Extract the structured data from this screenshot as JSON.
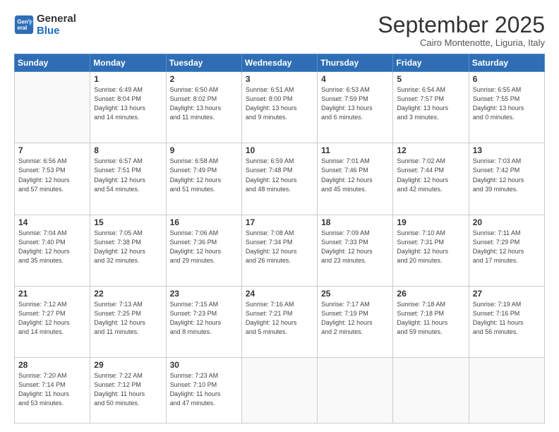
{
  "logo": {
    "text_general": "General",
    "text_blue": "Blue"
  },
  "header": {
    "month": "September 2025",
    "location": "Cairo Montenotte, Liguria, Italy"
  },
  "weekdays": [
    "Sunday",
    "Monday",
    "Tuesday",
    "Wednesday",
    "Thursday",
    "Friday",
    "Saturday"
  ],
  "weeks": [
    [
      {
        "day": "",
        "info": ""
      },
      {
        "day": "1",
        "info": "Sunrise: 6:49 AM\nSunset: 8:04 PM\nDaylight: 13 hours\nand 14 minutes."
      },
      {
        "day": "2",
        "info": "Sunrise: 6:50 AM\nSunset: 8:02 PM\nDaylight: 13 hours\nand 11 minutes."
      },
      {
        "day": "3",
        "info": "Sunrise: 6:51 AM\nSunset: 8:00 PM\nDaylight: 13 hours\nand 9 minutes."
      },
      {
        "day": "4",
        "info": "Sunrise: 6:53 AM\nSunset: 7:59 PM\nDaylight: 13 hours\nand 6 minutes."
      },
      {
        "day": "5",
        "info": "Sunrise: 6:54 AM\nSunset: 7:57 PM\nDaylight: 13 hours\nand 3 minutes."
      },
      {
        "day": "6",
        "info": "Sunrise: 6:55 AM\nSunset: 7:55 PM\nDaylight: 13 hours\nand 0 minutes."
      }
    ],
    [
      {
        "day": "7",
        "info": "Sunrise: 6:56 AM\nSunset: 7:53 PM\nDaylight: 12 hours\nand 57 minutes."
      },
      {
        "day": "8",
        "info": "Sunrise: 6:57 AM\nSunset: 7:51 PM\nDaylight: 12 hours\nand 54 minutes."
      },
      {
        "day": "9",
        "info": "Sunrise: 6:58 AM\nSunset: 7:49 PM\nDaylight: 12 hours\nand 51 minutes."
      },
      {
        "day": "10",
        "info": "Sunrise: 6:59 AM\nSunset: 7:48 PM\nDaylight: 12 hours\nand 48 minutes."
      },
      {
        "day": "11",
        "info": "Sunrise: 7:01 AM\nSunset: 7:46 PM\nDaylight: 12 hours\nand 45 minutes."
      },
      {
        "day": "12",
        "info": "Sunrise: 7:02 AM\nSunset: 7:44 PM\nDaylight: 12 hours\nand 42 minutes."
      },
      {
        "day": "13",
        "info": "Sunrise: 7:03 AM\nSunset: 7:42 PM\nDaylight: 12 hours\nand 39 minutes."
      }
    ],
    [
      {
        "day": "14",
        "info": "Sunrise: 7:04 AM\nSunset: 7:40 PM\nDaylight: 12 hours\nand 35 minutes."
      },
      {
        "day": "15",
        "info": "Sunrise: 7:05 AM\nSunset: 7:38 PM\nDaylight: 12 hours\nand 32 minutes."
      },
      {
        "day": "16",
        "info": "Sunrise: 7:06 AM\nSunset: 7:36 PM\nDaylight: 12 hours\nand 29 minutes."
      },
      {
        "day": "17",
        "info": "Sunrise: 7:08 AM\nSunset: 7:34 PM\nDaylight: 12 hours\nand 26 minutes."
      },
      {
        "day": "18",
        "info": "Sunrise: 7:09 AM\nSunset: 7:33 PM\nDaylight: 12 hours\nand 23 minutes."
      },
      {
        "day": "19",
        "info": "Sunrise: 7:10 AM\nSunset: 7:31 PM\nDaylight: 12 hours\nand 20 minutes."
      },
      {
        "day": "20",
        "info": "Sunrise: 7:11 AM\nSunset: 7:29 PM\nDaylight: 12 hours\nand 17 minutes."
      }
    ],
    [
      {
        "day": "21",
        "info": "Sunrise: 7:12 AM\nSunset: 7:27 PM\nDaylight: 12 hours\nand 14 minutes."
      },
      {
        "day": "22",
        "info": "Sunrise: 7:13 AM\nSunset: 7:25 PM\nDaylight: 12 hours\nand 11 minutes."
      },
      {
        "day": "23",
        "info": "Sunrise: 7:15 AM\nSunset: 7:23 PM\nDaylight: 12 hours\nand 8 minutes."
      },
      {
        "day": "24",
        "info": "Sunrise: 7:16 AM\nSunset: 7:21 PM\nDaylight: 12 hours\nand 5 minutes."
      },
      {
        "day": "25",
        "info": "Sunrise: 7:17 AM\nSunset: 7:19 PM\nDaylight: 12 hours\nand 2 minutes."
      },
      {
        "day": "26",
        "info": "Sunrise: 7:18 AM\nSunset: 7:18 PM\nDaylight: 11 hours\nand 59 minutes."
      },
      {
        "day": "27",
        "info": "Sunrise: 7:19 AM\nSunset: 7:16 PM\nDaylight: 11 hours\nand 56 minutes."
      }
    ],
    [
      {
        "day": "28",
        "info": "Sunrise: 7:20 AM\nSunset: 7:14 PM\nDaylight: 11 hours\nand 53 minutes."
      },
      {
        "day": "29",
        "info": "Sunrise: 7:22 AM\nSunset: 7:12 PM\nDaylight: 11 hours\nand 50 minutes."
      },
      {
        "day": "30",
        "info": "Sunrise: 7:23 AM\nSunset: 7:10 PM\nDaylight: 11 hours\nand 47 minutes."
      },
      {
        "day": "",
        "info": ""
      },
      {
        "day": "",
        "info": ""
      },
      {
        "day": "",
        "info": ""
      },
      {
        "day": "",
        "info": ""
      }
    ]
  ]
}
